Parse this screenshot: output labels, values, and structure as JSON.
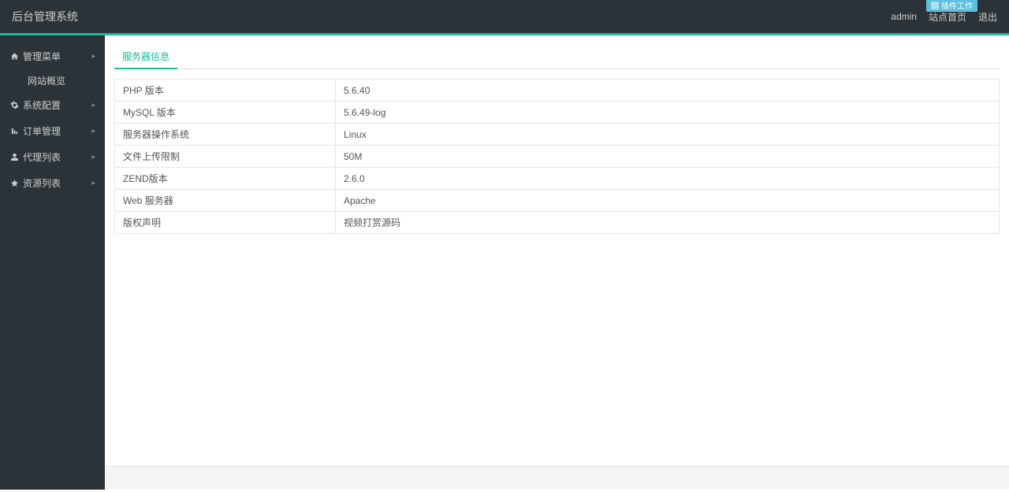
{
  "header": {
    "title": "后台管理系统",
    "badge": "插件工作",
    "user": "admin",
    "home": "站点首页",
    "logout": "退出"
  },
  "sidebar": {
    "items": [
      {
        "label": "管理菜单",
        "icon": "home"
      },
      {
        "label": "系统配置",
        "icon": "cog"
      },
      {
        "label": "订单管理",
        "icon": "bars"
      },
      {
        "label": "代理列表",
        "icon": "user"
      },
      {
        "label": "资源列表",
        "icon": "star"
      }
    ],
    "subitem": "网站概览"
  },
  "main": {
    "tab": "服务器信息",
    "rows": [
      {
        "key": "PHP 版本",
        "value": "5.6.40"
      },
      {
        "key": "MySQL 版本",
        "value": "5.6.49-log"
      },
      {
        "key": "服务器操作系统",
        "value": "Linux"
      },
      {
        "key": "文件上传限制",
        "value": "50M"
      },
      {
        "key": "ZEND版本",
        "value": "2.6.0"
      },
      {
        "key": "Web 服务器",
        "value": "Apache"
      },
      {
        "key": "版权声明",
        "value": "视频打赏源码"
      }
    ]
  }
}
